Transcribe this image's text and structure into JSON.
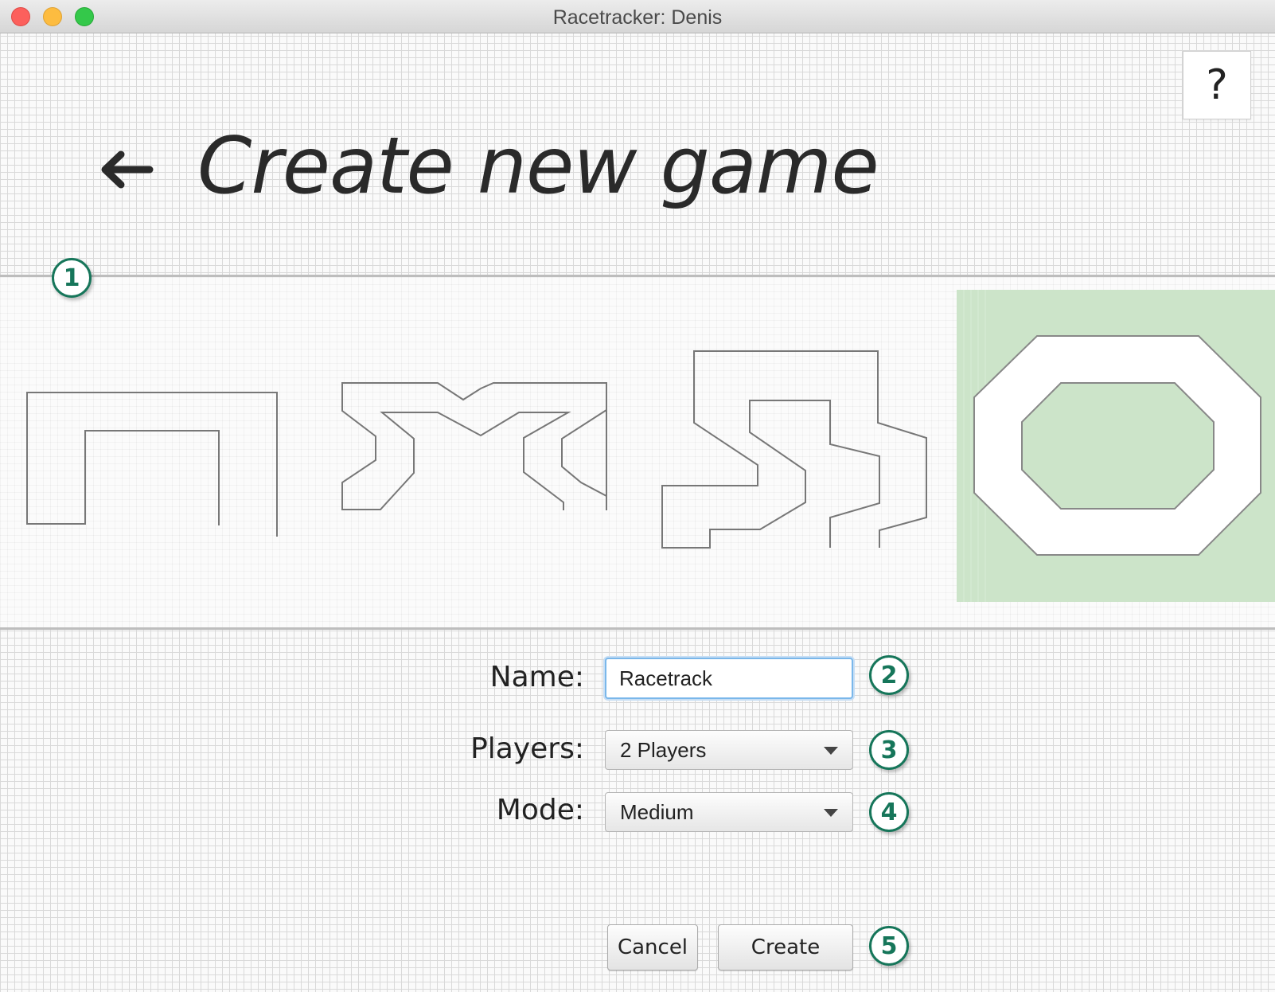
{
  "window": {
    "title": "Racetracker: Denis"
  },
  "header": {
    "title": "Create new game",
    "help_label": "?"
  },
  "tracks": {
    "count": 4,
    "selected_index": 3,
    "selected_color": "#cce4c9"
  },
  "badges": [
    "1",
    "2",
    "3",
    "4",
    "5"
  ],
  "form": {
    "name_label": "Name:",
    "name_value": "Racetrack",
    "players_label": "Players:",
    "players_value": "2 Players",
    "mode_label": "Mode:",
    "mode_value": "Medium"
  },
  "buttons": {
    "cancel": "Cancel",
    "create": "Create"
  },
  "colors": {
    "badge": "#16765a",
    "input_focus": "#7ab7ea",
    "grid": "#d9d9d9"
  }
}
